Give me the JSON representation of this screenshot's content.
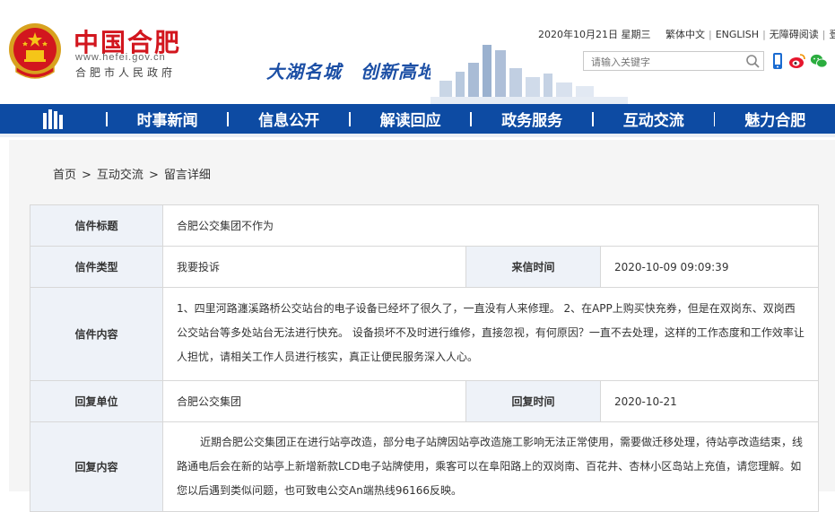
{
  "header": {
    "site_name": "中国合肥",
    "site_url": "www.hefei.gov.cn",
    "site_sub": "合肥市人民政府",
    "slogan": "大湖名城　创新高地",
    "date": "2020年10月21日 星期三",
    "top_links": [
      "繁体中文",
      "ENGLISH",
      "无障碍阅读",
      "登录"
    ],
    "search_placeholder": "请输入关键字",
    "icons": [
      "search-icon",
      "mobile-icon",
      "weibo-icon",
      "wechat-icon"
    ]
  },
  "nav": {
    "home_icon": "home-icon",
    "items": [
      "时事新闻",
      "信息公开",
      "解读回应",
      "政务服务",
      "互动交流",
      "魅力合肥"
    ]
  },
  "breadcrumb": [
    "首页",
    ">",
    "互动交流",
    ">",
    "留言详细"
  ],
  "letter": {
    "title_label": "信件标题",
    "title_value": "合肥公交集团不作为",
    "type_label": "信件类型",
    "type_value": "我要投诉",
    "time_label": "来信时间",
    "time_value": "2020-10-09 09:09:39",
    "content_label": "信件内容",
    "content_value": "1、四里河路瀍溪路桥公交站台的电子设备已经坏了很久了，一直没有人来修理。 2、在APP上购买快充券，但是在双岗东、双岗西公交站台等多处站台无法进行快充。 设备损坏不及时进行维修，直接忽视，有何原因？一直不去处理，这样的工作态度和工作效率让人担忧，请相关工作人员进行核实，真正让便民服务深入人心。",
    "reply_unit_label": "回复单位",
    "reply_unit_value": "合肥公交集团",
    "reply_time_label": "回复时间",
    "reply_time_value": "2020-10-21",
    "reply_content_label": "回复内容",
    "reply_content_value": "近期合肥公交集团正在进行站亭改造，部分电子站牌因站亭改造施工影响无法正常使用，需要做迁移处理，待站亭改造结束，线路通电后会在新的站亭上新增新款LCD电子站牌使用，乘客可以在阜阳路上的双岗南、百花井、杏林小区岛站上充值，请您理解。如您以后遇到类似问题，也可致电公交An端热线96166反映。"
  },
  "colors": {
    "nav_blue": "#0d4ba3",
    "brand_red": "#d2161e",
    "label_blue": "#1a54a6",
    "label_bg": "#eef2f8"
  }
}
